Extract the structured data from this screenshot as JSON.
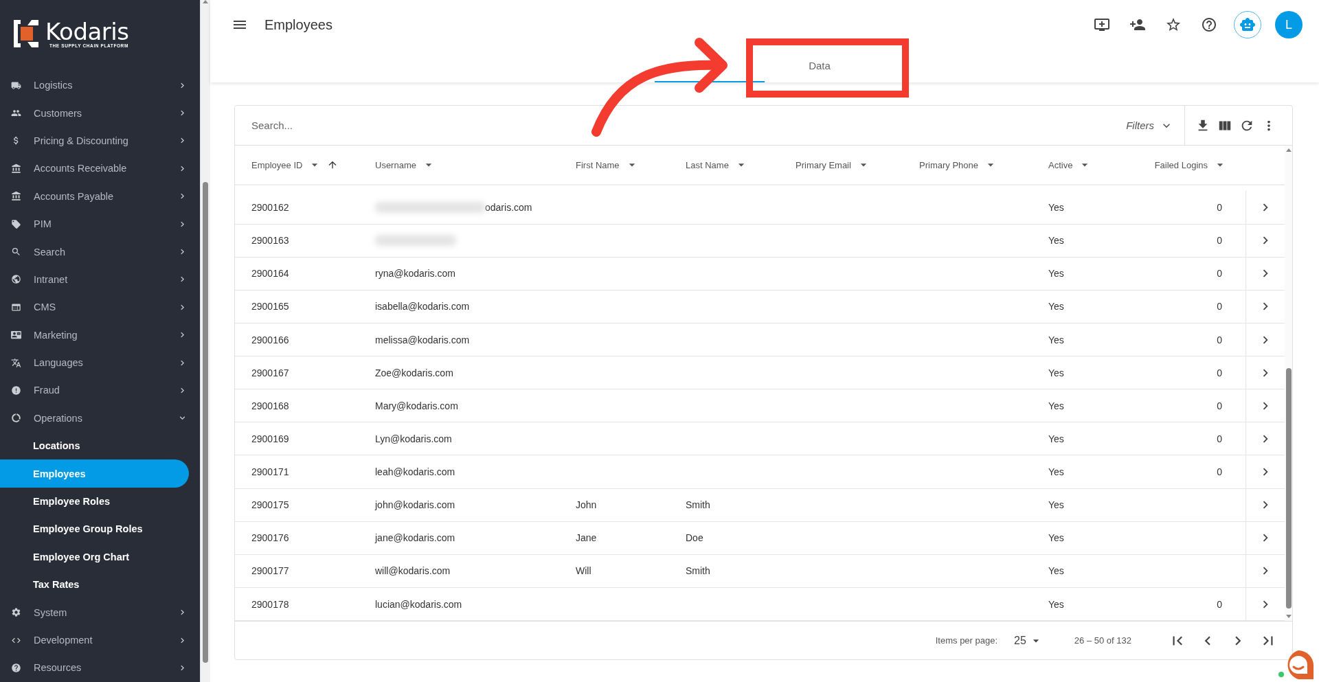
{
  "brand": {
    "name": "Kodaris",
    "tagline": "THE SUPPLY CHAIN PLATFORM"
  },
  "sidebar": {
    "items": [
      {
        "label": "Logistics",
        "expanded": false
      },
      {
        "label": "Customers",
        "expanded": false
      },
      {
        "label": "Pricing & Discounting",
        "expanded": false
      },
      {
        "label": "Accounts Receivable",
        "expanded": false
      },
      {
        "label": "Accounts Payable",
        "expanded": false
      },
      {
        "label": "PIM",
        "expanded": false
      },
      {
        "label": "Search",
        "expanded": false
      },
      {
        "label": "Intranet",
        "expanded": false
      },
      {
        "label": "CMS",
        "expanded": false
      },
      {
        "label": "Marketing",
        "expanded": false
      },
      {
        "label": "Languages",
        "expanded": false
      },
      {
        "label": "Fraud",
        "expanded": false
      },
      {
        "label": "Operations",
        "expanded": true,
        "children": [
          {
            "label": "Locations",
            "selected": false
          },
          {
            "label": "Employees",
            "selected": true
          },
          {
            "label": "Employee Roles",
            "selected": false
          },
          {
            "label": "Employee Group Roles",
            "selected": false
          },
          {
            "label": "Employee Org Chart",
            "selected": false
          },
          {
            "label": "Tax Rates",
            "selected": false
          }
        ]
      },
      {
        "label": "System",
        "expanded": false
      },
      {
        "label": "Development",
        "expanded": false
      },
      {
        "label": "Resources",
        "expanded": false
      }
    ]
  },
  "header": {
    "title": "Employees",
    "avatar": "L"
  },
  "tabs": [
    {
      "selected": true
    },
    {
      "label": "Data",
      "selected": false
    }
  ],
  "table": {
    "search": {
      "placeholder": "Search..."
    },
    "filters": "Filters",
    "columns": [
      {
        "label": "Employee ID",
        "sorted_ascending": true
      },
      {
        "label": "Username"
      },
      {
        "label": "First Name"
      },
      {
        "label": "Last Name"
      },
      {
        "label": "Primary Email"
      },
      {
        "label": "Primary Phone"
      },
      {
        "label": "Active"
      },
      {
        "label": "Failed Logins"
      }
    ],
    "rows": [
      {
        "id": "2900162",
        "username": "odaris.com",
        "redacted": true,
        "active": "Yes",
        "failed_logins": "0"
      },
      {
        "id": "2900163",
        "redacted": true,
        "active": "Yes",
        "failed_logins": "0"
      },
      {
        "id": "2900164",
        "username": "ryna@kodaris.com",
        "active": "Yes",
        "failed_logins": "0"
      },
      {
        "id": "2900165",
        "username": "isabella@kodaris.com",
        "active": "Yes",
        "failed_logins": "0"
      },
      {
        "id": "2900166",
        "username": "melissa@kodaris.com",
        "active": "Yes",
        "failed_logins": "0"
      },
      {
        "id": "2900167",
        "username": "Zoe@kodaris.com",
        "active": "Yes",
        "failed_logins": "0"
      },
      {
        "id": "2900168",
        "username": "Mary@kodaris.com",
        "active": "Yes",
        "failed_logins": "0"
      },
      {
        "id": "2900169",
        "username": "Lyn@kodaris.com",
        "active": "Yes",
        "failed_logins": "0"
      },
      {
        "id": "2900171",
        "username": "leah@kodaris.com",
        "active": "Yes",
        "failed_logins": "0"
      },
      {
        "id": "2900175",
        "username": "john@kodaris.com",
        "first_name": "John",
        "last_name": "Smith",
        "active": "Yes"
      },
      {
        "id": "2900176",
        "username": "jane@kodaris.com",
        "first_name": "Jane",
        "last_name": "Doe",
        "active": "Yes"
      },
      {
        "id": "2900177",
        "username": "will@kodaris.com",
        "first_name": "Will",
        "last_name": "Smith",
        "active": "Yes"
      },
      {
        "id": "2900178",
        "username": "lucian@kodaris.com",
        "active": "Yes",
        "failed_logins": "0"
      }
    ],
    "pagination": {
      "items_per_page_label": "Items per page:",
      "items_per_page": "25",
      "range": "26 – 50 of 132"
    }
  }
}
